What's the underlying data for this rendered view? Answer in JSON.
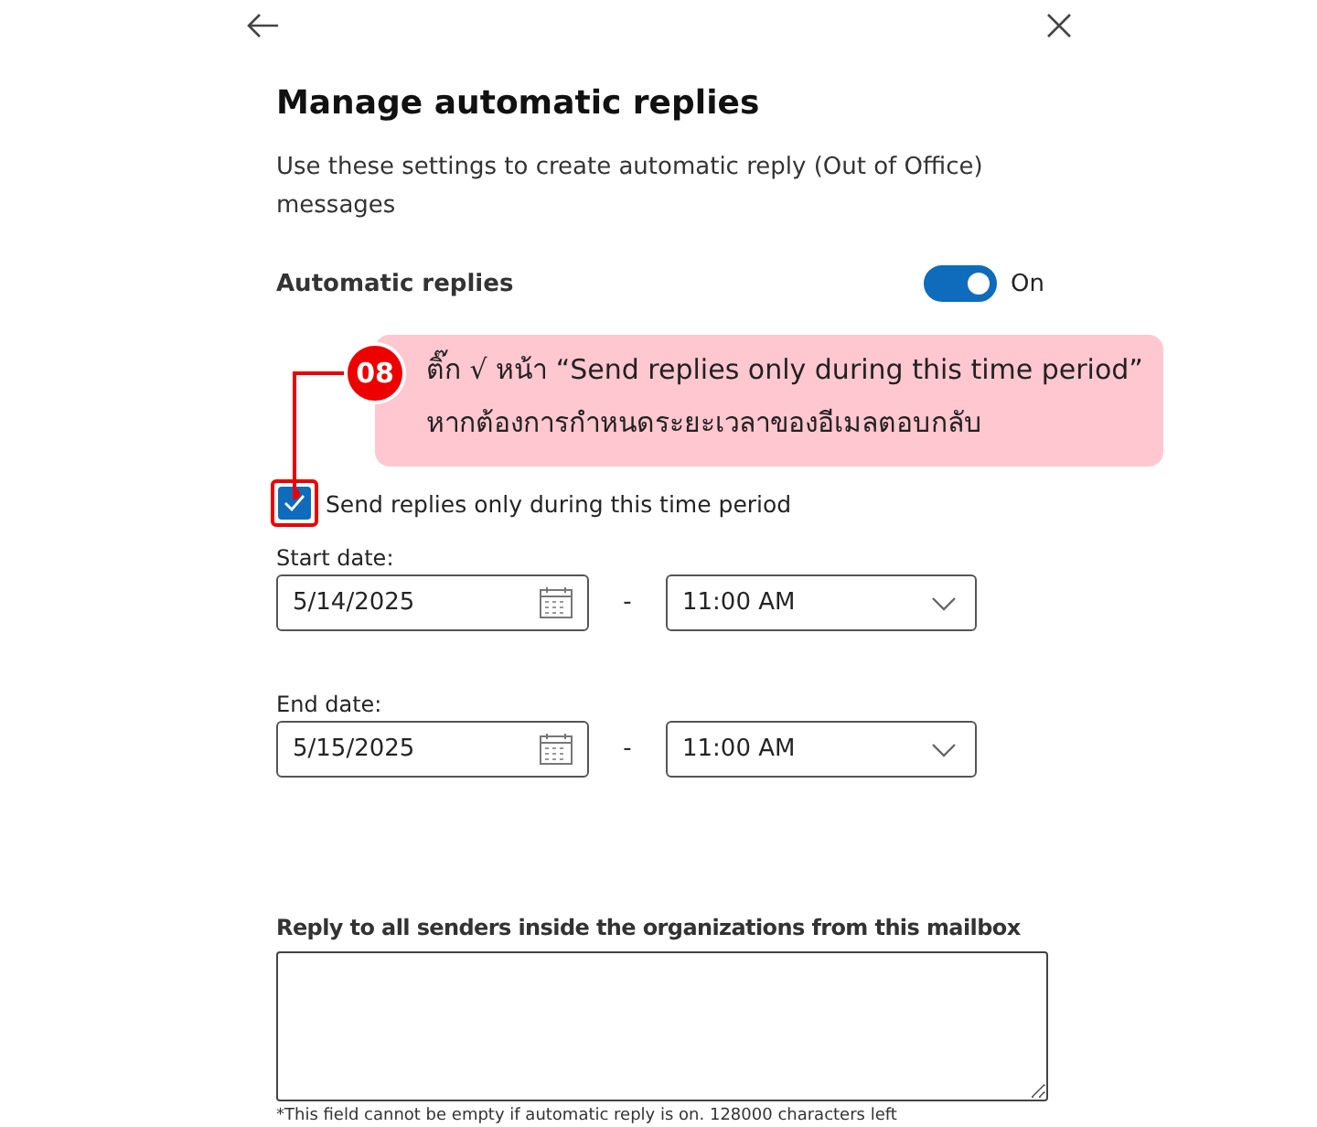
{
  "header": {
    "title": "Manage automatic replies",
    "description": "Use these settings to create automatic reply (Out of Office) messages"
  },
  "automatic_replies": {
    "label": "Automatic replies",
    "on": true,
    "state_text": "On"
  },
  "callout": {
    "step": "08",
    "line_1": "ติ๊ก √ หน้า “Send replies only during this time period”",
    "line_2": "หากต้องการกำหนดระยะเวลาของอีเมลตอบกลับ"
  },
  "time_period": {
    "label": "Send replies only during this time period",
    "checked": true
  },
  "dates": [
    {
      "label": "Start date:",
      "date": "5/14/2025",
      "separator": "-",
      "time": "11:00 AM"
    },
    {
      "label": "End date:",
      "date": "5/15/2025",
      "separator": "-",
      "time": "11:00 AM"
    }
  ],
  "reply_inside": {
    "label": "Reply to all senders inside the organizations from this mailbox",
    "note": "*This field cannot be empty if automatic reply is on. 128000 characters left"
  }
}
